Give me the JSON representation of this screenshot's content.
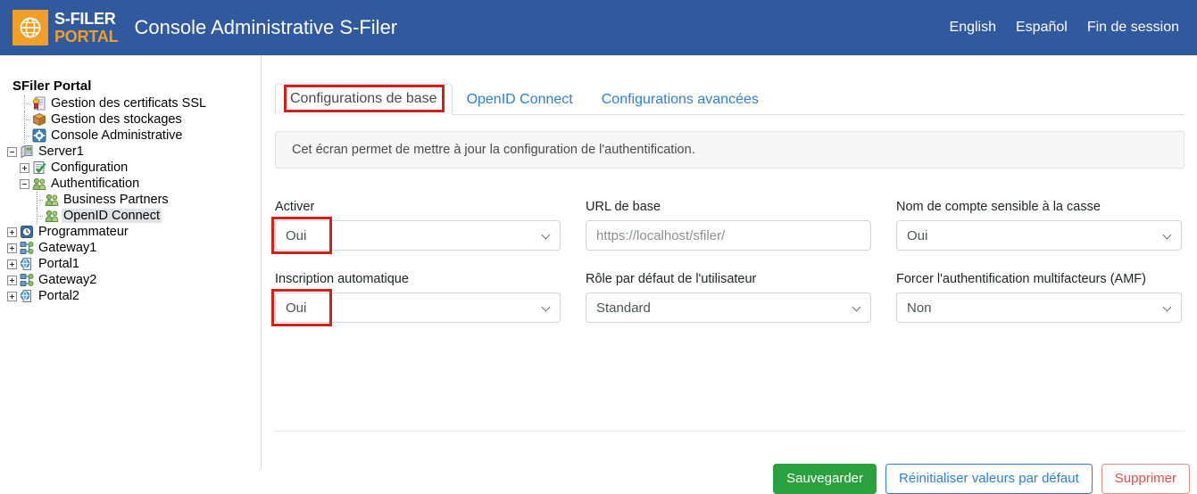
{
  "header": {
    "logo_line1": "S-FILER",
    "logo_line2": "PORTAL",
    "logo_icon": "globe-icon",
    "app_title": "Console Administrative S-Filer",
    "nav": [
      {
        "label": "English",
        "name": "lang-english"
      },
      {
        "label": "Español",
        "name": "lang-espanol"
      },
      {
        "label": "Fin de session",
        "name": "logout"
      }
    ],
    "bg_color": "#30599E",
    "accent_color": "#F0A028"
  },
  "sidebar": {
    "root_label": "SFiler Portal",
    "nodes": [
      {
        "label": "Gestion des certificats SSL",
        "icon": "certificate-icon",
        "depth": 1,
        "toggle": "none",
        "selected": false
      },
      {
        "label": "Gestion des stockages",
        "icon": "package-icon",
        "depth": 1,
        "toggle": "none",
        "selected": false
      },
      {
        "label": "Console Administrative",
        "icon": "gear-icon",
        "depth": 1,
        "toggle": "none",
        "selected": false
      },
      {
        "label": "Server1",
        "icon": "server-icon",
        "depth": 0,
        "toggle": "minus",
        "selected": false
      },
      {
        "label": "Configuration",
        "icon": "checklist-icon",
        "depth": 1,
        "toggle": "plus",
        "selected": false
      },
      {
        "label": "Authentification",
        "icon": "users-icon",
        "depth": 1,
        "toggle": "minus",
        "selected": false
      },
      {
        "label": "Business Partners",
        "icon": "users-icon",
        "depth": 2,
        "toggle": "none",
        "selected": false
      },
      {
        "label": "OpenID Connect",
        "icon": "users-icon",
        "depth": 2,
        "toggle": "none",
        "selected": true
      },
      {
        "label": "Programmateur",
        "icon": "clock-icon",
        "depth": 0,
        "toggle": "plus",
        "selected": false
      },
      {
        "label": "Gateway1",
        "icon": "network-icon",
        "depth": 0,
        "toggle": "plus",
        "selected": false
      },
      {
        "label": "Portal1",
        "icon": "portal-icon",
        "depth": 0,
        "toggle": "plus",
        "selected": false
      },
      {
        "label": "Gateway2",
        "icon": "network-icon",
        "depth": 0,
        "toggle": "plus",
        "selected": false
      },
      {
        "label": "Portal2",
        "icon": "portal-icon",
        "depth": 0,
        "toggle": "plus",
        "selected": false
      }
    ]
  },
  "main": {
    "tabs": [
      {
        "label": "Configurations de base",
        "active": true
      },
      {
        "label": "OpenID Connect",
        "active": false
      },
      {
        "label": "Configurations avancées",
        "active": false
      }
    ],
    "banner_text": "Cet écran permet de mettre à jour la configuration de l'authentification.",
    "fields": {
      "activer": {
        "label": "Activer",
        "value": "Oui",
        "type": "select",
        "highlighted": true
      },
      "url_de_base": {
        "label": "URL de base",
        "value": "",
        "placeholder": "https://localhost/sfiler/",
        "type": "text",
        "highlighted": false
      },
      "nom_compte_casse": {
        "label": "Nom de compte sensible à la casse",
        "value": "Oui",
        "type": "select",
        "highlighted": false
      },
      "inscription_auto": {
        "label": "Inscription automatique",
        "value": "Oui",
        "type": "select",
        "highlighted": true
      },
      "role_defaut": {
        "label": "Rôle par défaut de l'utilisateur",
        "value": "Standard",
        "type": "select",
        "highlighted": false
      },
      "forcer_amf": {
        "label": "Forcer l'authentification multifacteurs (AMF)",
        "value": "Non",
        "type": "select",
        "highlighted": false
      }
    },
    "buttons": {
      "save": "Sauvegarder",
      "reset": "Réinitialiser valeurs par défaut",
      "delete": "Supprimer"
    }
  },
  "annotation_color": "#D0211C"
}
